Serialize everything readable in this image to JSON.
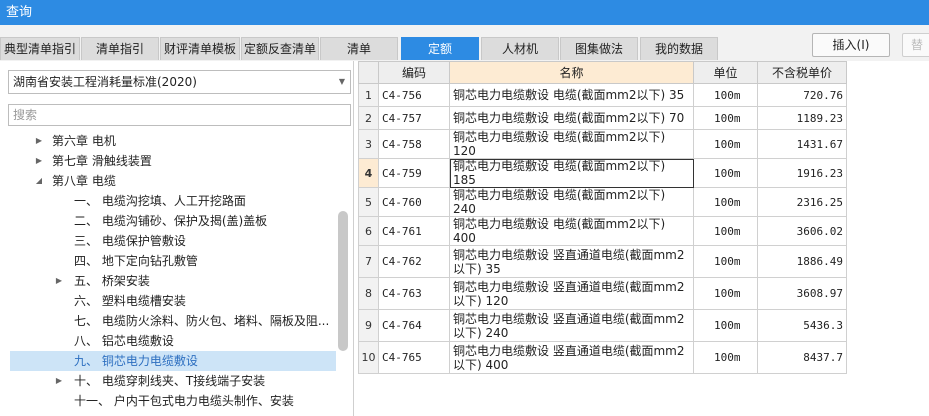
{
  "window": {
    "title": "查询"
  },
  "tabs": [
    {
      "label": "典型清单指引",
      "active": false
    },
    {
      "label": "清单指引",
      "active": false
    },
    {
      "label": "财评清单模板",
      "active": false
    },
    {
      "label": "定额反查清单",
      "active": false
    },
    {
      "label": "清单",
      "active": false
    },
    {
      "label": "定额",
      "active": true
    },
    {
      "label": "人材机",
      "active": false
    },
    {
      "label": "图集做法",
      "active": false
    },
    {
      "label": "我的数据",
      "active": false
    }
  ],
  "toolbar": {
    "insert_label": "插入(I)",
    "extra_label": "替"
  },
  "left": {
    "library": "湖南省安装工程消耗量标准(2020)",
    "search_placeholder": "搜索",
    "tree": [
      {
        "label": "第六章 电机",
        "expander": "▶",
        "selected": false
      },
      {
        "label": "第七章 滑触线装置",
        "expander": "▶",
        "selected": false
      },
      {
        "label": "第八章 电缆",
        "expander": "◢",
        "selected": false
      },
      {
        "label": "一、 电缆沟挖填、人工开挖路面",
        "expander": "",
        "selected": false
      },
      {
        "label": "二、 电缆沟铺砂、保护及揭(盖)盖板",
        "expander": "",
        "selected": false
      },
      {
        "label": "三、 电缆保护管敷设",
        "expander": "",
        "selected": false
      },
      {
        "label": "四、 地下定向钻孔敷管",
        "expander": "",
        "selected": false
      },
      {
        "label": "五、 桥架安装",
        "expander": "▶",
        "selected": false
      },
      {
        "label": "六、 塑料电缆槽安装",
        "expander": "",
        "selected": false
      },
      {
        "label": "七、 电缆防火涂料、防火包、堵料、隔板及阻...",
        "expander": "",
        "selected": false
      },
      {
        "label": "八、 铝芯电缆敷设",
        "expander": "",
        "selected": false
      },
      {
        "label": "九、 铜芯电力电缆敷设",
        "expander": "",
        "selected": true
      },
      {
        "label": "十、 电缆穿刺线夹、T接线端子安装",
        "expander": "▶",
        "selected": false
      },
      {
        "label": "十一、 户内干包式电力电缆头制作、安装",
        "expander": "",
        "selected": false
      }
    ]
  },
  "grid": {
    "headers": {
      "code": "编码",
      "name": "名称",
      "unit": "单位",
      "price": "不含税单价"
    },
    "rows": [
      {
        "num": "1",
        "code": "C4-756",
        "name": "铜芯电力电缆敷设 电缆(截面mm2以下) 35",
        "unit": "100m",
        "price": "720.76"
      },
      {
        "num": "2",
        "code": "C4-757",
        "name": "铜芯电力电缆敷设 电缆(截面mm2以下) 70",
        "unit": "100m",
        "price": "1189.23"
      },
      {
        "num": "3",
        "code": "C4-758",
        "name": "铜芯电力电缆敷设 电缆(截面mm2以下) 120",
        "unit": "100m",
        "price": "1431.67"
      },
      {
        "num": "4",
        "code": "C4-759",
        "name": "铜芯电力电缆敷设 电缆(截面mm2以下) 185",
        "unit": "100m",
        "price": "1916.23"
      },
      {
        "num": "5",
        "code": "C4-760",
        "name": "铜芯电力电缆敷设 电缆(截面mm2以下) 240",
        "unit": "100m",
        "price": "2316.25"
      },
      {
        "num": "6",
        "code": "C4-761",
        "name": "铜芯电力电缆敷设 电缆(截面mm2以下) 400",
        "unit": "100m",
        "price": "3606.02"
      },
      {
        "num": "7",
        "code": "C4-762",
        "name": "铜芯电力电缆敷设 竖直通道电缆(截面mm2以下) 35",
        "unit": "100m",
        "price": "1886.49"
      },
      {
        "num": "8",
        "code": "C4-763",
        "name": "铜芯电力电缆敷设 竖直通道电缆(截面mm2以下) 120",
        "unit": "100m",
        "price": "3608.97"
      },
      {
        "num": "9",
        "code": "C4-764",
        "name": "铜芯电力电缆敷设 竖直通道电缆(截面mm2以下) 240",
        "unit": "100m",
        "price": "5436.3"
      },
      {
        "num": "10",
        "code": "C4-765",
        "name": "铜芯电力电缆敷设 竖直通道电缆(截面mm2以下) 400",
        "unit": "100m",
        "price": "8437.7"
      }
    ]
  }
}
